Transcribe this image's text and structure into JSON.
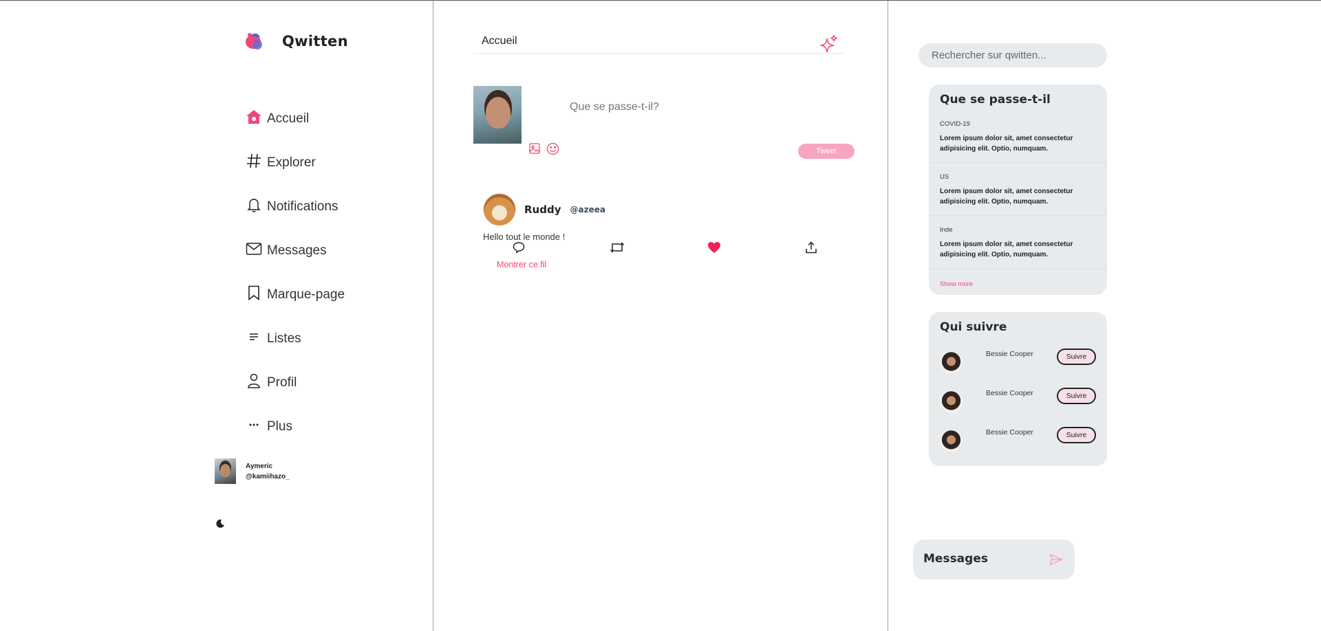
{
  "app": {
    "name": "Qwitten"
  },
  "nav": {
    "items": [
      {
        "label": "Accueil",
        "icon": "home-icon"
      },
      {
        "label": "Explorer",
        "icon": "hashtag-icon"
      },
      {
        "label": "Notifications",
        "icon": "bell-icon"
      },
      {
        "label": "Messages",
        "icon": "mail-icon"
      },
      {
        "label": "Marque-page",
        "icon": "bookmark-icon"
      },
      {
        "label": "Listes",
        "icon": "list-icon"
      },
      {
        "label": "Profil",
        "icon": "user-icon"
      },
      {
        "label": "Plus",
        "icon": "more-icon"
      }
    ]
  },
  "account": {
    "name": "Aymeric",
    "handle": "@kamiihazo_"
  },
  "center": {
    "title": "Accueil",
    "compose_placeholder": "Que se passe-t-il?",
    "tweet_button": "Tweet"
  },
  "tweet": {
    "name": "Ruddy",
    "handle": "@azeea",
    "text": "Hello tout le monde !",
    "show_thread": "Montrer ce fil"
  },
  "search": {
    "placeholder": "Rechercher sur qwitten..."
  },
  "trends": {
    "title": "Que se passe-t-il",
    "items": [
      {
        "category": "COVID-19",
        "text": "Lorem ipsum dolor sit, amet consectetur adipisicing elit. Optio, numquam."
      },
      {
        "category": "US",
        "text": "Lorem ipsum dolor sit, amet consectetur adipisicing elit. Optio, numquam."
      },
      {
        "category": "Inde",
        "text": "Lorem ipsum dolor sit, amet consectetur adipisicing elit. Optio, numquam."
      }
    ],
    "show_more": "Show more"
  },
  "who_to_follow": {
    "title": "Qui suivre",
    "items": [
      {
        "name": "Bessie Cooper",
        "button": "Suivre"
      },
      {
        "name": "Bessie Cooper",
        "button": "Suivre"
      },
      {
        "name": "Bessie Cooper",
        "button": "Suivre"
      }
    ]
  },
  "messages_drawer": {
    "title": "Messages"
  },
  "colors": {
    "accent": "#f2476c",
    "tweet_button": "#f7a5c0",
    "card_bg": "#e8ebee"
  }
}
